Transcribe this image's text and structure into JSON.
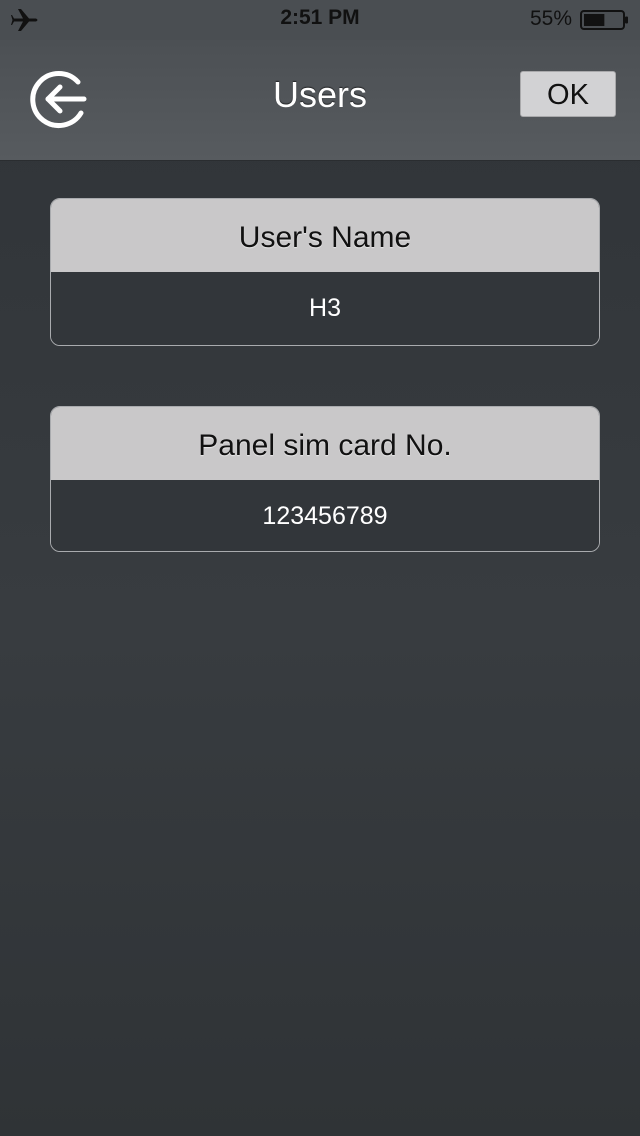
{
  "status_bar": {
    "time": "2:51 PM",
    "battery_percent": "55%",
    "airplane_icon": "airplane-icon",
    "battery_icon": "battery-icon",
    "battery_level": 0.55
  },
  "nav_bar": {
    "title": "Users",
    "back_icon": "back-arrow-circle-icon",
    "ok_label": "OK"
  },
  "form": {
    "user_name": {
      "label": "User's Name",
      "value": "H3"
    },
    "sim_card": {
      "label": "Panel sim card No.",
      "value": "123456789"
    }
  },
  "colors": {
    "background": "#35393d",
    "nav_bar": "#54585c",
    "card_header": "#c9c8c9",
    "card_value_bg": "#32363a",
    "ok_button": "#d2d2d4"
  }
}
